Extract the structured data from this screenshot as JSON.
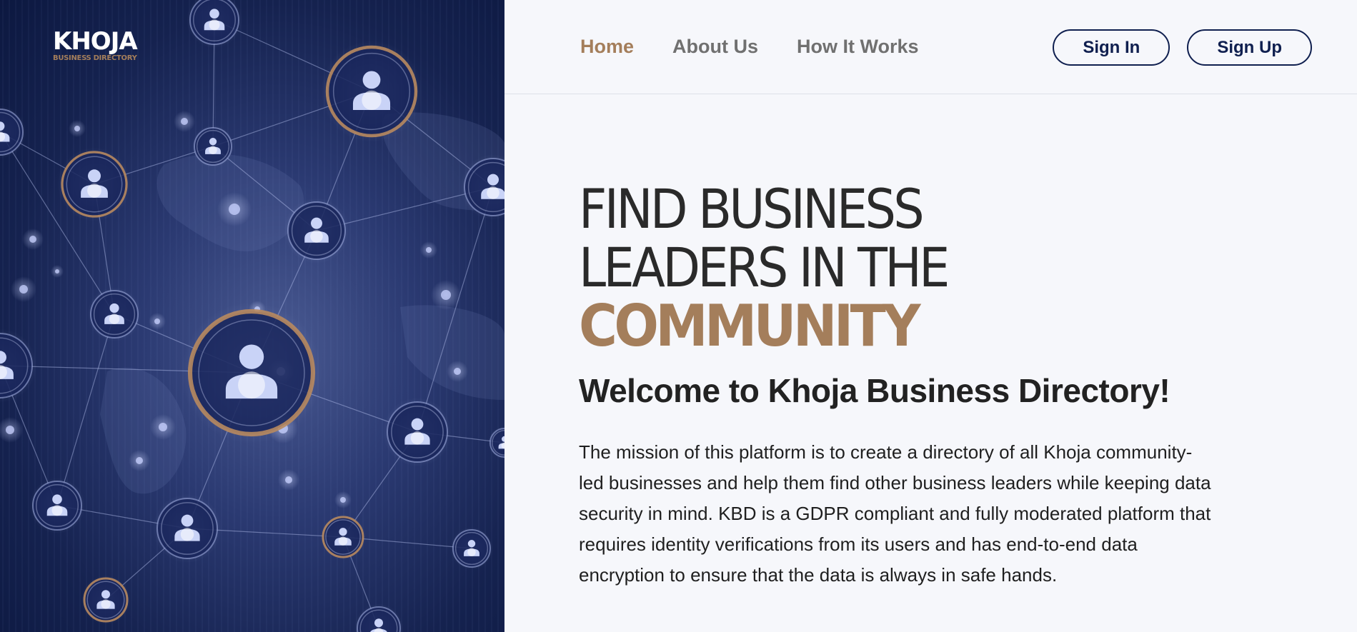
{
  "brand": {
    "name": "KHOJA",
    "tagline": "BUSINESS DIRECTORY"
  },
  "nav": {
    "items": [
      {
        "label": "Home",
        "active": true
      },
      {
        "label": "About Us",
        "active": false
      },
      {
        "label": "How It Works",
        "active": false
      }
    ]
  },
  "auth": {
    "sign_in": "Sign In",
    "sign_up": "Sign Up"
  },
  "hero": {
    "headline_line1": "FIND BUSINESS",
    "headline_line2": "LEADERS IN THE",
    "headline_accent": "COMMUNITY",
    "welcome": "Welcome to Khoja Business Directory!",
    "mission": "The mission of this platform is to create a directory of all Khoja community-led businesses and help them find other business leaders while keeping data security in mind. KBD is a GDPR compliant and fully moderated platform that requires identity verifications from its users and has end-to-end data encryption to ensure that the data is always in safe hands."
  },
  "colors": {
    "accent": "#a47e5b",
    "navy": "#0f1f4f",
    "panel_dark": "#0c1840",
    "page_bg": "#f6f7fb"
  },
  "illustration": {
    "icon": "network-people-illustration"
  }
}
